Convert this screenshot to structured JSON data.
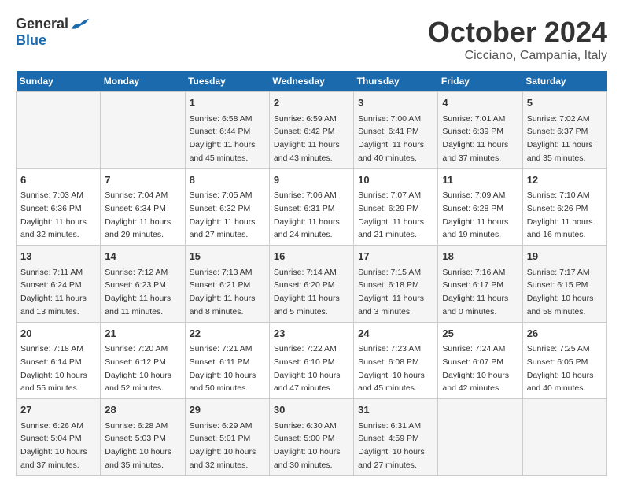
{
  "header": {
    "logo_general": "General",
    "logo_blue": "Blue",
    "title": "October 2024",
    "location": "Cicciano, Campania, Italy"
  },
  "calendar": {
    "days_of_week": [
      "Sunday",
      "Monday",
      "Tuesday",
      "Wednesday",
      "Thursday",
      "Friday",
      "Saturday"
    ],
    "weeks": [
      [
        {
          "day": "",
          "info": ""
        },
        {
          "day": "",
          "info": ""
        },
        {
          "day": "1",
          "info": "Sunrise: 6:58 AM\nSunset: 6:44 PM\nDaylight: 11 hours and 45 minutes."
        },
        {
          "day": "2",
          "info": "Sunrise: 6:59 AM\nSunset: 6:42 PM\nDaylight: 11 hours and 43 minutes."
        },
        {
          "day": "3",
          "info": "Sunrise: 7:00 AM\nSunset: 6:41 PM\nDaylight: 11 hours and 40 minutes."
        },
        {
          "day": "4",
          "info": "Sunrise: 7:01 AM\nSunset: 6:39 PM\nDaylight: 11 hours and 37 minutes."
        },
        {
          "day": "5",
          "info": "Sunrise: 7:02 AM\nSunset: 6:37 PM\nDaylight: 11 hours and 35 minutes."
        }
      ],
      [
        {
          "day": "6",
          "info": "Sunrise: 7:03 AM\nSunset: 6:36 PM\nDaylight: 11 hours and 32 minutes."
        },
        {
          "day": "7",
          "info": "Sunrise: 7:04 AM\nSunset: 6:34 PM\nDaylight: 11 hours and 29 minutes."
        },
        {
          "day": "8",
          "info": "Sunrise: 7:05 AM\nSunset: 6:32 PM\nDaylight: 11 hours and 27 minutes."
        },
        {
          "day": "9",
          "info": "Sunrise: 7:06 AM\nSunset: 6:31 PM\nDaylight: 11 hours and 24 minutes."
        },
        {
          "day": "10",
          "info": "Sunrise: 7:07 AM\nSunset: 6:29 PM\nDaylight: 11 hours and 21 minutes."
        },
        {
          "day": "11",
          "info": "Sunrise: 7:09 AM\nSunset: 6:28 PM\nDaylight: 11 hours and 19 minutes."
        },
        {
          "day": "12",
          "info": "Sunrise: 7:10 AM\nSunset: 6:26 PM\nDaylight: 11 hours and 16 minutes."
        }
      ],
      [
        {
          "day": "13",
          "info": "Sunrise: 7:11 AM\nSunset: 6:24 PM\nDaylight: 11 hours and 13 minutes."
        },
        {
          "day": "14",
          "info": "Sunrise: 7:12 AM\nSunset: 6:23 PM\nDaylight: 11 hours and 11 minutes."
        },
        {
          "day": "15",
          "info": "Sunrise: 7:13 AM\nSunset: 6:21 PM\nDaylight: 11 hours and 8 minutes."
        },
        {
          "day": "16",
          "info": "Sunrise: 7:14 AM\nSunset: 6:20 PM\nDaylight: 11 hours and 5 minutes."
        },
        {
          "day": "17",
          "info": "Sunrise: 7:15 AM\nSunset: 6:18 PM\nDaylight: 11 hours and 3 minutes."
        },
        {
          "day": "18",
          "info": "Sunrise: 7:16 AM\nSunset: 6:17 PM\nDaylight: 11 hours and 0 minutes."
        },
        {
          "day": "19",
          "info": "Sunrise: 7:17 AM\nSunset: 6:15 PM\nDaylight: 10 hours and 58 minutes."
        }
      ],
      [
        {
          "day": "20",
          "info": "Sunrise: 7:18 AM\nSunset: 6:14 PM\nDaylight: 10 hours and 55 minutes."
        },
        {
          "day": "21",
          "info": "Sunrise: 7:20 AM\nSunset: 6:12 PM\nDaylight: 10 hours and 52 minutes."
        },
        {
          "day": "22",
          "info": "Sunrise: 7:21 AM\nSunset: 6:11 PM\nDaylight: 10 hours and 50 minutes."
        },
        {
          "day": "23",
          "info": "Sunrise: 7:22 AM\nSunset: 6:10 PM\nDaylight: 10 hours and 47 minutes."
        },
        {
          "day": "24",
          "info": "Sunrise: 7:23 AM\nSunset: 6:08 PM\nDaylight: 10 hours and 45 minutes."
        },
        {
          "day": "25",
          "info": "Sunrise: 7:24 AM\nSunset: 6:07 PM\nDaylight: 10 hours and 42 minutes."
        },
        {
          "day": "26",
          "info": "Sunrise: 7:25 AM\nSunset: 6:05 PM\nDaylight: 10 hours and 40 minutes."
        }
      ],
      [
        {
          "day": "27",
          "info": "Sunrise: 6:26 AM\nSunset: 5:04 PM\nDaylight: 10 hours and 37 minutes."
        },
        {
          "day": "28",
          "info": "Sunrise: 6:28 AM\nSunset: 5:03 PM\nDaylight: 10 hours and 35 minutes."
        },
        {
          "day": "29",
          "info": "Sunrise: 6:29 AM\nSunset: 5:01 PM\nDaylight: 10 hours and 32 minutes."
        },
        {
          "day": "30",
          "info": "Sunrise: 6:30 AM\nSunset: 5:00 PM\nDaylight: 10 hours and 30 minutes."
        },
        {
          "day": "31",
          "info": "Sunrise: 6:31 AM\nSunset: 4:59 PM\nDaylight: 10 hours and 27 minutes."
        },
        {
          "day": "",
          "info": ""
        },
        {
          "day": "",
          "info": ""
        }
      ]
    ]
  }
}
